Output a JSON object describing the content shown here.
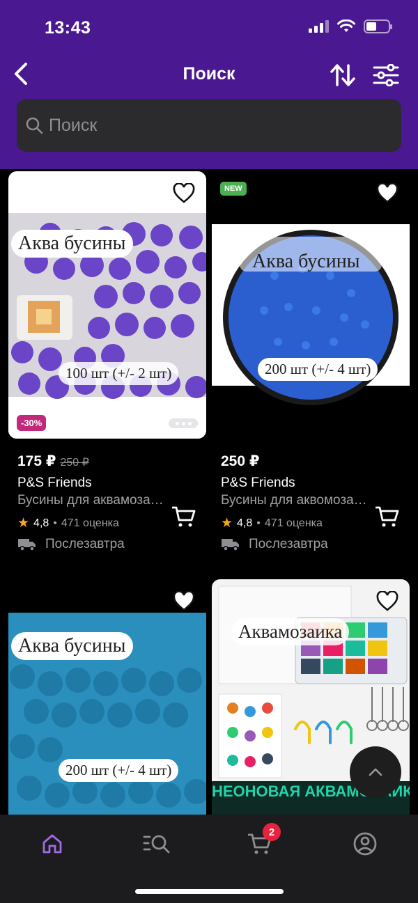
{
  "status_bar": {
    "time": "13:43"
  },
  "nav": {
    "title": "Поиск"
  },
  "search": {
    "placeholder": "Поиск",
    "value": ""
  },
  "products": [
    {
      "image_text": "Аква бусины",
      "image_subtext": "100 шт (+/- 2 шт)",
      "badge": "-30%",
      "price": "175 ₽",
      "old_price": "250 ₽",
      "brand": "P&S Friends",
      "title": "Бусины для аквамозаики",
      "rating": "4,8",
      "reviews": "471 оценка",
      "delivery": "Послезавтра",
      "image_color": "#6a45c8"
    },
    {
      "image_text": "Аква бусины",
      "image_subtext": "200 шт (+/- 4 шт)",
      "badge": "NEW",
      "price": "250 ₽",
      "brand": "P&S Friends",
      "title": "Бусины для аквомозаики",
      "rating": "4,8",
      "reviews": "471 оценка",
      "delivery": "Послезавтра",
      "image_color": "#2b5fd0"
    },
    {
      "image_text": "Аква бусины",
      "image_subtext": "200 шт (+/- 4 шт)",
      "image_color": "#1f86b3"
    },
    {
      "image_text": "Аквамозаика",
      "image_subtext": "НЕОНОВАЯ АКВАМОЗАИКА",
      "image_color": "#f3f3f3"
    }
  ],
  "tabbar": {
    "cart_badge": "2"
  },
  "colors": {
    "header": "#4a1890",
    "accent": "#a06ae8",
    "badge": "#e8223c"
  }
}
